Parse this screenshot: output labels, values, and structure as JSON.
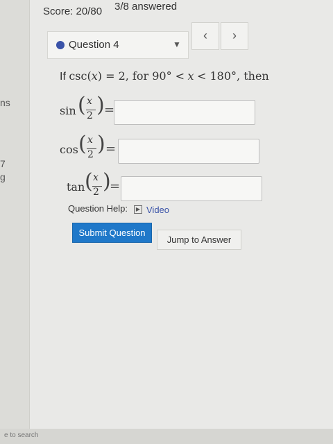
{
  "header": {
    "score": "Score: 20/80",
    "answered": "3/8 answered"
  },
  "question_nav": {
    "label": "Question 4",
    "prev_icon": "chevron-left-icon",
    "next_icon": "chevron-right-icon",
    "dropdown_icon": "caret-down-icon"
  },
  "question": {
    "intro": "If",
    "csc": "csc(",
    "x1": "x",
    "mid": ") = 2, for 90° <",
    "x2": "x",
    "end": "< 180°, then",
    "rows": [
      {
        "fn": "sin",
        "num": "x",
        "den": "2",
        "eq": "="
      },
      {
        "fn": "cos",
        "num": "x",
        "den": "2",
        "eq": "="
      },
      {
        "fn": "tan",
        "num": "x",
        "den": "2",
        "eq": "="
      }
    ],
    "help_label": "Question Help:",
    "video_label": "Video"
  },
  "actions": {
    "submit": "Submit Question",
    "jump": "Jump to Answer"
  },
  "left_edge": {
    "t1": "ns",
    "t2": "7",
    "t3": "g",
    "search": "e to search"
  },
  "colors": {
    "accent": "#1f78c9",
    "link": "#3a53a8"
  }
}
